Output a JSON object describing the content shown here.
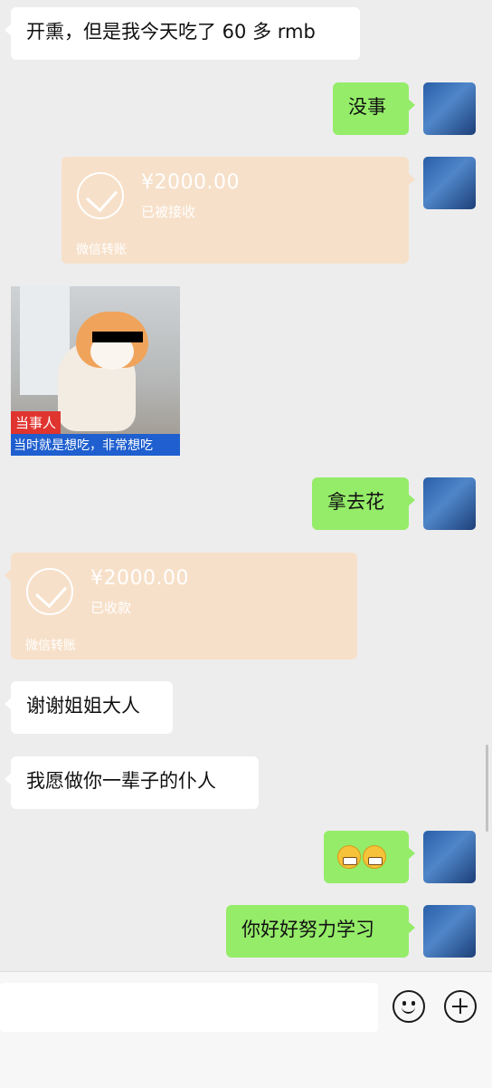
{
  "messages": {
    "m1_text": "开熏，但是我今天吃了 60 多 rmb",
    "m2_text": "没事",
    "t1": {
      "amount": "¥2000.00",
      "status": "已被接收",
      "footer": "微信转账"
    },
    "sticker": {
      "tag_top": "当事人",
      "tag_bottom": "当时就是想吃，非常想吃"
    },
    "m4_text": "拿去花",
    "t2": {
      "amount": "¥2000.00",
      "status": "已收款",
      "footer": "微信转账"
    },
    "m6_text": "谢谢姐姐大人",
    "m7_text": "我愿做你一辈子的仆人",
    "m8_emojis": [
      "grin-emoji",
      "grin-emoji"
    ],
    "m9_text": "你好好努力学习"
  },
  "input_bar": {
    "placeholder": ""
  },
  "icons": [
    "emoji-icon",
    "plus-icon",
    "check-icon"
  ],
  "colors": {
    "background": "#ededed",
    "bubble_sent": "#95ec69",
    "bubble_received": "#ffffff",
    "transfer": "#f7e0c9",
    "tag_red": "#e0342f",
    "tag_blue": "#1f5fcf"
  }
}
